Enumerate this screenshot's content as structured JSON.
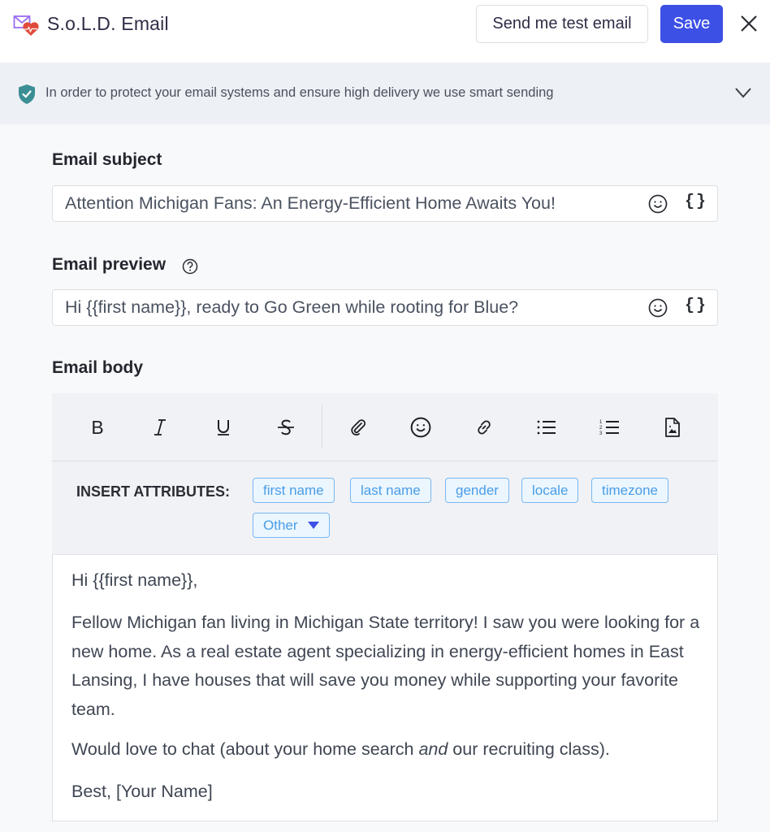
{
  "header": {
    "app_title": "S.o.L.D. Email",
    "logo_icon": "envelope-heart-icon",
    "send_test_label": "Send me test email",
    "save_label": "Save",
    "close_icon": "close-icon",
    "colors": {
      "primary": "#3d50e6",
      "logo_envelope": "#9b6ef0",
      "logo_heart": "#e04a3b"
    }
  },
  "banner": {
    "icon": "shield-check-icon",
    "text": "In order to protect your email systems and ensure high delivery we use smart sending",
    "expand_icon": "chevron-down-icon",
    "colors": {
      "shield": "#3b8f94"
    }
  },
  "subject": {
    "label": "Email subject",
    "value": "Attention Michigan Fans: An Energy-Efficient Home Awaits You!",
    "emoji_icon": "smiley-icon",
    "variable_label": "{}"
  },
  "preview": {
    "label": "Email preview",
    "help_icon": "question-circle-icon",
    "value": "Hi {{first name}}, ready to Go Green while rooting for Blue?",
    "emoji_icon": "smiley-icon",
    "variable_label": "{}"
  },
  "body": {
    "label": "Email body",
    "toolbar": [
      "bold",
      "italic",
      "underline",
      "strikethrough",
      "attachment",
      "emoji",
      "link",
      "bulleted-list",
      "numbered-list",
      "image"
    ],
    "toolbar_glyphs": {
      "bold": "B",
      "italic": "I",
      "underline": "U",
      "strikethrough": "S"
    },
    "insert_attributes_label": "INSERT ATTRIBUTES:",
    "attributes": [
      "first name",
      "last name",
      "gender",
      "locale",
      "timezone"
    ],
    "other_dropdown_label": "Other",
    "content": {
      "greeting": "Hi {{first name}},",
      "paragraph1": "Fellow Michigan fan living in Michigan State territory! I saw you were looking for a new home. As a real estate agent specializing in energy-efficient homes in East Lansing, I have houses that will save you money while supporting your favorite team.",
      "paragraph2_before": "Would love to chat (about your home search ",
      "paragraph2_italic": "and",
      "paragraph2_after": " our recruiting class).",
      "signoff": "Best, [Your Name]"
    }
  }
}
